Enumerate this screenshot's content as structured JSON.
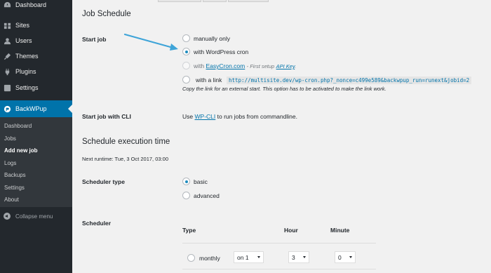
{
  "sidebar": {
    "items": [
      {
        "label": "Dashboard",
        "icon": "dashboard-icon"
      },
      {
        "label": "Sites",
        "icon": "sites-icon"
      },
      {
        "label": "Users",
        "icon": "users-icon"
      },
      {
        "label": "Themes",
        "icon": "themes-icon"
      },
      {
        "label": "Plugins",
        "icon": "plugins-icon"
      },
      {
        "label": "Settings",
        "icon": "settings-icon"
      },
      {
        "label": "BackWPup",
        "icon": "backwpup-icon",
        "active": true
      }
    ],
    "submenu": [
      {
        "label": "Dashboard"
      },
      {
        "label": "Jobs"
      },
      {
        "label": "Add new job",
        "current": true
      },
      {
        "label": "Logs"
      },
      {
        "label": "Backups"
      },
      {
        "label": "Settings"
      },
      {
        "label": "About"
      }
    ],
    "collapse_label": "Collapse menu"
  },
  "colors": {
    "sidebar_bg": "#23282d",
    "submenu_bg": "#32373c",
    "accent": "#0073aa",
    "page_bg": "#f1f1f1",
    "arrow": "#3ea4d8"
  },
  "job_schedule": {
    "title": "Job Schedule",
    "start_job_label": "Start job",
    "options": {
      "manual": "manually only",
      "wpcron": "with WordPress cron",
      "easycron_prefix": "with",
      "easycron_link": "EasyCron.com",
      "easycron_note": "- First setup",
      "easycron_api": "API Key",
      "easycron_end": ".",
      "link": "with a link",
      "link_url": "http://multisite.dev/wp-cron.php?_nonce=c499e589&backwpup_run=runext&jobid=2"
    },
    "link_help": "Copy the link for an external start. This option has to be activated to make the link work.",
    "cli_label": "Start job with CLI",
    "cli_use": "Use",
    "cli_link": "WP-CLI",
    "cli_rest": "to run jobs from commandline."
  },
  "schedule_exec": {
    "title": "Schedule execution time",
    "next_runtime": "Next runtime: Tue, 3 Oct 2017, 03:00",
    "type_label": "Scheduler type",
    "type_basic": "basic",
    "type_advanced": "advanced",
    "scheduler_label": "Scheduler",
    "col_type": "Type",
    "col_hour": "Hour",
    "col_minute": "Minute",
    "row_monthly": "monthly",
    "sel_day": "on 1",
    "sel_hour": "3",
    "sel_minute": "0"
  }
}
